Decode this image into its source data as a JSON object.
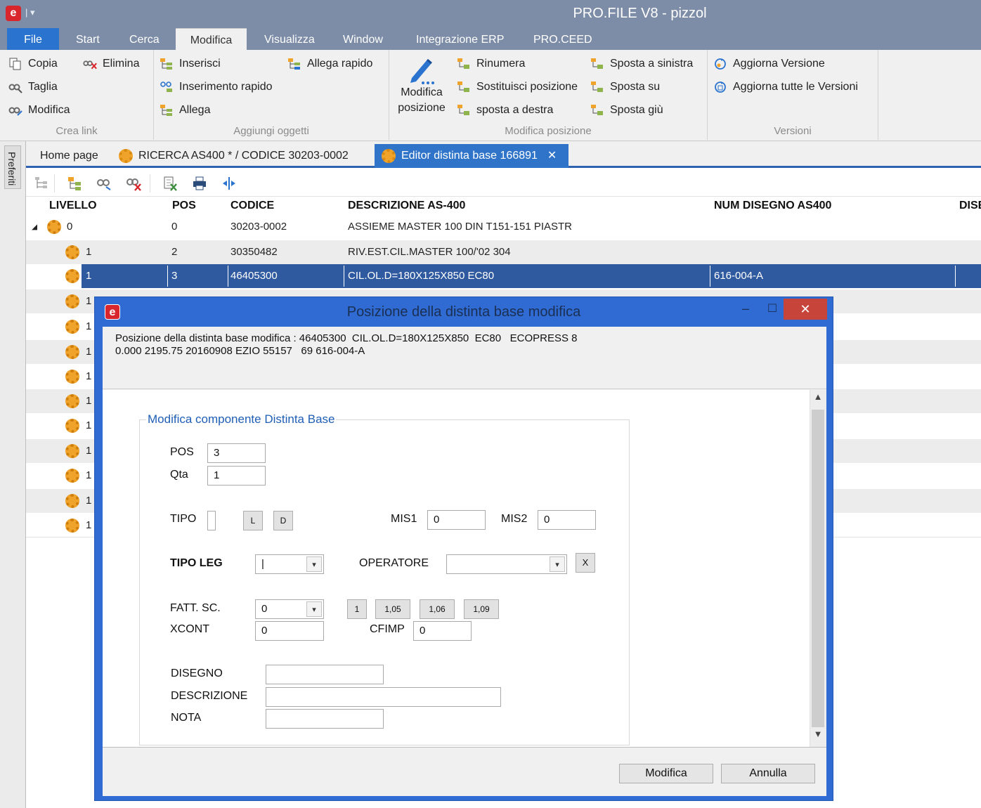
{
  "app": {
    "title": "PRO.FILE V8 - pizzol",
    "logo_glyph": "e",
    "qa_glyph": "| ▾"
  },
  "menu": {
    "tabs": [
      "File",
      "Start",
      "Cerca",
      "Modifica",
      "Visualizza",
      "Window",
      "Integrazione ERP",
      "PRO.CEED"
    ],
    "active": "Modifica"
  },
  "ribbon": {
    "crea_link": {
      "label": "Crea link",
      "items": [
        "Copia",
        "Elimina",
        "Taglia",
        "Modifica"
      ]
    },
    "aggiungi_oggetti": {
      "label": "Aggiungi oggetti",
      "items": [
        "Inserisci",
        "Allega rapido",
        "Inserimento rapido",
        "Allega"
      ]
    },
    "modifica_posizione": {
      "label": "Modifica posizione",
      "big_button": [
        "Modifica",
        "posizione"
      ],
      "items": [
        "Rinumera",
        "Sposta a sinistra",
        "Sostituisci posizione",
        "Sposta su",
        "sposta a destra",
        "Sposta giù"
      ]
    },
    "versioni": {
      "label": "Versioni",
      "items": [
        "Aggiorna Versione",
        "Aggiorna tutte le Versioni"
      ]
    }
  },
  "sidebar": {
    "preferiti_label": "Preferiti"
  },
  "doc_tabs": [
    {
      "label": "Home page"
    },
    {
      "label": "RICERCA AS400 * / CODICE 30203-0002"
    },
    {
      "label": "Editor distinta base 166891",
      "close": "✕"
    }
  ],
  "grid": {
    "columns": [
      "LIVELLO",
      "POS",
      "CODICE",
      "DESCRIZIONE AS-400",
      "NUM DISEGNO AS400",
      "DISE"
    ],
    "rows": [
      {
        "livello": "0",
        "pos": "0",
        "codice": "30203-0002",
        "descrizione": "ASSIEME MASTER 100 DIN  T151-151 PIASTR",
        "disegno": ""
      },
      {
        "livello": "1",
        "pos": "2",
        "codice": "30350482",
        "descrizione": "RIV.EST.CIL.MASTER 100/'02 304",
        "disegno": ""
      },
      {
        "livello": "1",
        "pos": "3",
        "codice": "46405300",
        "descrizione": "CIL.OL.D=180X125X850  EC80",
        "disegno": "616-004-A"
      }
    ],
    "hidden_rows_livello": [
      "1",
      "1",
      "1",
      "1",
      "1",
      "1",
      "1",
      "1",
      "1",
      "1"
    ],
    "expand_glyph": "◢"
  },
  "dialog": {
    "title": "Posizione della distinta base modifica",
    "info_line1": "Posizione della distinta base modifica : 46405300  CIL.OL.D=180X125X850  EC80   ECOPRESS 8",
    "info_line2": "0.000 2195.75 20160908 EZIO 55157   69 616-004-A",
    "group_title": "Modifica componente Distinta Base",
    "fields": {
      "pos": {
        "label": "POS",
        "value": "3"
      },
      "qta": {
        "label": "Qta",
        "value": "1"
      },
      "tipo": {
        "label": "TIPO",
        "btn_l": "L",
        "btn_d": "D"
      },
      "mis1": {
        "label": "MIS1",
        "value": "0"
      },
      "mis2": {
        "label": "MIS2",
        "value": "0"
      },
      "tipo_leg": {
        "label": "TIPO LEG",
        "value": "|"
      },
      "operatore": {
        "label": "OPERATORE",
        "value": "",
        "clear_btn": "X"
      },
      "fatt_sc": {
        "label": "FATT. SC.",
        "value": "0",
        "presets": [
          "1",
          "1,05",
          "1,06",
          "1,09"
        ]
      },
      "xcont": {
        "label": "XCONT",
        "value": "0"
      },
      "cfimp": {
        "label": "CFIMP",
        "value": "0"
      },
      "disegno": {
        "label": "DISEGNO",
        "value": ""
      },
      "descrizione": {
        "label": "DESCRIZIONE",
        "value": ""
      },
      "nota": {
        "label": "NOTA",
        "value": ""
      }
    },
    "buttons": {
      "ok": "Modifica",
      "cancel": "Annulla"
    },
    "window_controls": {
      "min": "–",
      "max": "☐",
      "close": "✕"
    },
    "combo_arrow": "▾",
    "scroll_up": "▲",
    "scroll_down": "▼"
  },
  "colors": {
    "titlebar": "#7d8da7",
    "file_tab": "#2a73cf",
    "selection": "#2f5aa0",
    "dialog_frame": "#2f6bd2",
    "close_red": "#c7443a",
    "group_title": "#1f5eb5"
  }
}
